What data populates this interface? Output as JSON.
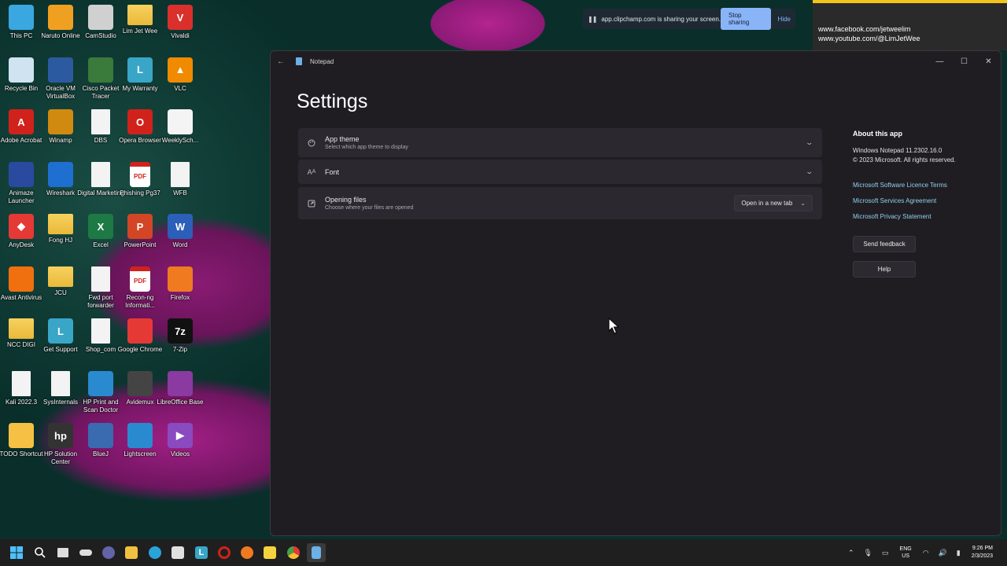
{
  "desktop": {
    "icons": [
      {
        "label": "This PC",
        "glyph": "",
        "color": "#3aa7e0"
      },
      {
        "label": "Naruto Online",
        "glyph": "",
        "color": "#f0a020"
      },
      {
        "label": "CamStudio",
        "glyph": "",
        "color": "#d0d0d0"
      },
      {
        "label": "Lim Jet Wee",
        "glyph": "",
        "color": "folder"
      },
      {
        "label": "Vivaldi",
        "glyph": "V",
        "color": "#d9302c"
      },
      {
        "label": "Recycle Bin",
        "glyph": "",
        "color": "#cfe3f0"
      },
      {
        "label": "Oracle VM VirtualBox",
        "glyph": "",
        "color": "#2c5aa0"
      },
      {
        "label": "Cisco Packet Tracer",
        "glyph": "",
        "color": "#3a7a3a"
      },
      {
        "label": "My Warranty",
        "glyph": "L",
        "color": "#39a6c8"
      },
      {
        "label": "VLC",
        "glyph": "▲",
        "color": "#f08a00"
      },
      {
        "label": "Adobe Acrobat",
        "glyph": "A",
        "color": "#d0221b"
      },
      {
        "label": "Winamp",
        "glyph": "",
        "color": "#d08a10"
      },
      {
        "label": "DBS",
        "glyph": "",
        "color": "file"
      },
      {
        "label": "Opera Browser",
        "glyph": "O",
        "color": "#d0221b"
      },
      {
        "label": "WeeklySch...",
        "glyph": "",
        "color": "#f4f4f4"
      },
      {
        "label": "Animaze Launcher",
        "glyph": "",
        "color": "#2a4aa0"
      },
      {
        "label": "Wireshark",
        "glyph": "",
        "color": "#1e6fd0"
      },
      {
        "label": "Digital Marketing",
        "glyph": "",
        "color": "file"
      },
      {
        "label": "Phishing Pg37",
        "glyph": "PDF",
        "color": "pdf"
      },
      {
        "label": "WFB",
        "glyph": "",
        "color": "file"
      },
      {
        "label": "AnyDesk",
        "glyph": "◆",
        "color": "#e53935"
      },
      {
        "label": "Fong HJ",
        "glyph": "",
        "color": "folder"
      },
      {
        "label": "Excel",
        "glyph": "X",
        "color": "#1d7a45"
      },
      {
        "label": "PowerPoint",
        "glyph": "P",
        "color": "#d24625"
      },
      {
        "label": "Word",
        "glyph": "W",
        "color": "#2b5fb8"
      },
      {
        "label": "Avast Antivirus",
        "glyph": "",
        "color": "#f07010"
      },
      {
        "label": "JCU",
        "glyph": "",
        "color": "folder"
      },
      {
        "label": "Fwd port forwarder",
        "glyph": "",
        "color": "file"
      },
      {
        "label": "Recon-ng Informati...",
        "glyph": "PDF",
        "color": "pdf"
      },
      {
        "label": "Firefox",
        "glyph": "",
        "color": "#f07a20"
      },
      {
        "label": "NCC DIGI",
        "glyph": "",
        "color": "folder"
      },
      {
        "label": "Get Support",
        "glyph": "L",
        "color": "#39a6c8"
      },
      {
        "label": "Shop_com",
        "glyph": "",
        "color": "file"
      },
      {
        "label": "Google Chrome",
        "glyph": "",
        "color": "#e53935"
      },
      {
        "label": "7-Zip",
        "glyph": "7z",
        "color": "#111111"
      },
      {
        "label": "Kali 2022.3",
        "glyph": "",
        "color": "file"
      },
      {
        "label": "SysInternals",
        "glyph": "",
        "color": "file"
      },
      {
        "label": "HP Print and Scan Doctor",
        "glyph": "",
        "color": "#2a8ad0"
      },
      {
        "label": "Avidemux",
        "glyph": "",
        "color": "#444444"
      },
      {
        "label": "LibreOffice Base",
        "glyph": "",
        "color": "#8a3aa0"
      },
      {
        "label": "TODO Shortcut",
        "glyph": "",
        "color": "#f5c043"
      },
      {
        "label": "HP Solution Center",
        "glyph": "hp",
        "color": "#333333"
      },
      {
        "label": "BlueJ",
        "glyph": "",
        "color": "#3a6ab0"
      },
      {
        "label": "Lightscreen",
        "glyph": "",
        "color": "#2a8ad0"
      },
      {
        "label": "Videos",
        "glyph": "▶",
        "color": "#8a4ac0"
      }
    ]
  },
  "share_bar": {
    "message": "app.clipchamp.com is sharing your screen.",
    "stop_label": "Stop sharing",
    "hide_label": "Hide"
  },
  "socials": {
    "line1": "www.facebook.com/jetweelim",
    "line2": "www.youtube.com/@LimJetWee"
  },
  "window": {
    "title": "Notepad",
    "page_title": "Settings",
    "settings": [
      {
        "name": "App theme",
        "desc": "Select which app theme to display",
        "icon": "palette-icon"
      },
      {
        "name": "Font",
        "desc": "",
        "icon": "font-icon"
      },
      {
        "name": "Opening files",
        "desc": "Choose where your files are opened",
        "icon": "open-file-icon",
        "value": "Open in a new tab"
      }
    ],
    "about": {
      "heading": "About this app",
      "version": "Windows Notepad 11.2302.16.0",
      "copyright": "© 2023 Microsoft. All rights reserved.",
      "links": [
        "Microsoft Software Licence Terms",
        "Microsoft Services Agreement",
        "Microsoft Privacy Statement"
      ],
      "feedback_label": "Send feedback",
      "help_label": "Help"
    }
  },
  "taskbar": {
    "language": "ENG",
    "region": "US",
    "time": "9:26 PM",
    "date": "2/3/2023"
  },
  "colors": {
    "accent": "#8ab4f8",
    "link": "#8fd1ea",
    "window_bg": "#201d22",
    "card_bg": "#2b2830"
  }
}
